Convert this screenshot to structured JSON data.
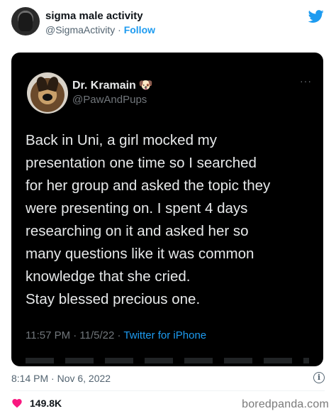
{
  "outer_tweet": {
    "display_name": "sigma male activity",
    "handle": "@SigmaActivity",
    "separator": " · ",
    "follow_label": "Follow",
    "timestamp": "8:14 PM · Nov 6, 2022",
    "like_count": "149.8K",
    "info_icon": "info-icon",
    "brand_color": "#1d9bf0"
  },
  "embedded_tweet": {
    "display_name": "Dr. Kramain",
    "name_emoji": "🐶",
    "handle": "@PawAndPups",
    "more_label": "···",
    "body_lines": [
      "Back in Uni, a girl mocked my",
      "presentation one time so I searched",
      "for her group and asked the topic they",
      "were presenting on. I spent 4 days",
      "researching on it and asked her so",
      "many questions like it was common",
      "knowledge that she cried.",
      "Stay blessed precious one."
    ],
    "time": "11:57 PM · 11/5/22 · ",
    "source": "Twitter for iPhone"
  },
  "watermark": "boredpanda.com"
}
